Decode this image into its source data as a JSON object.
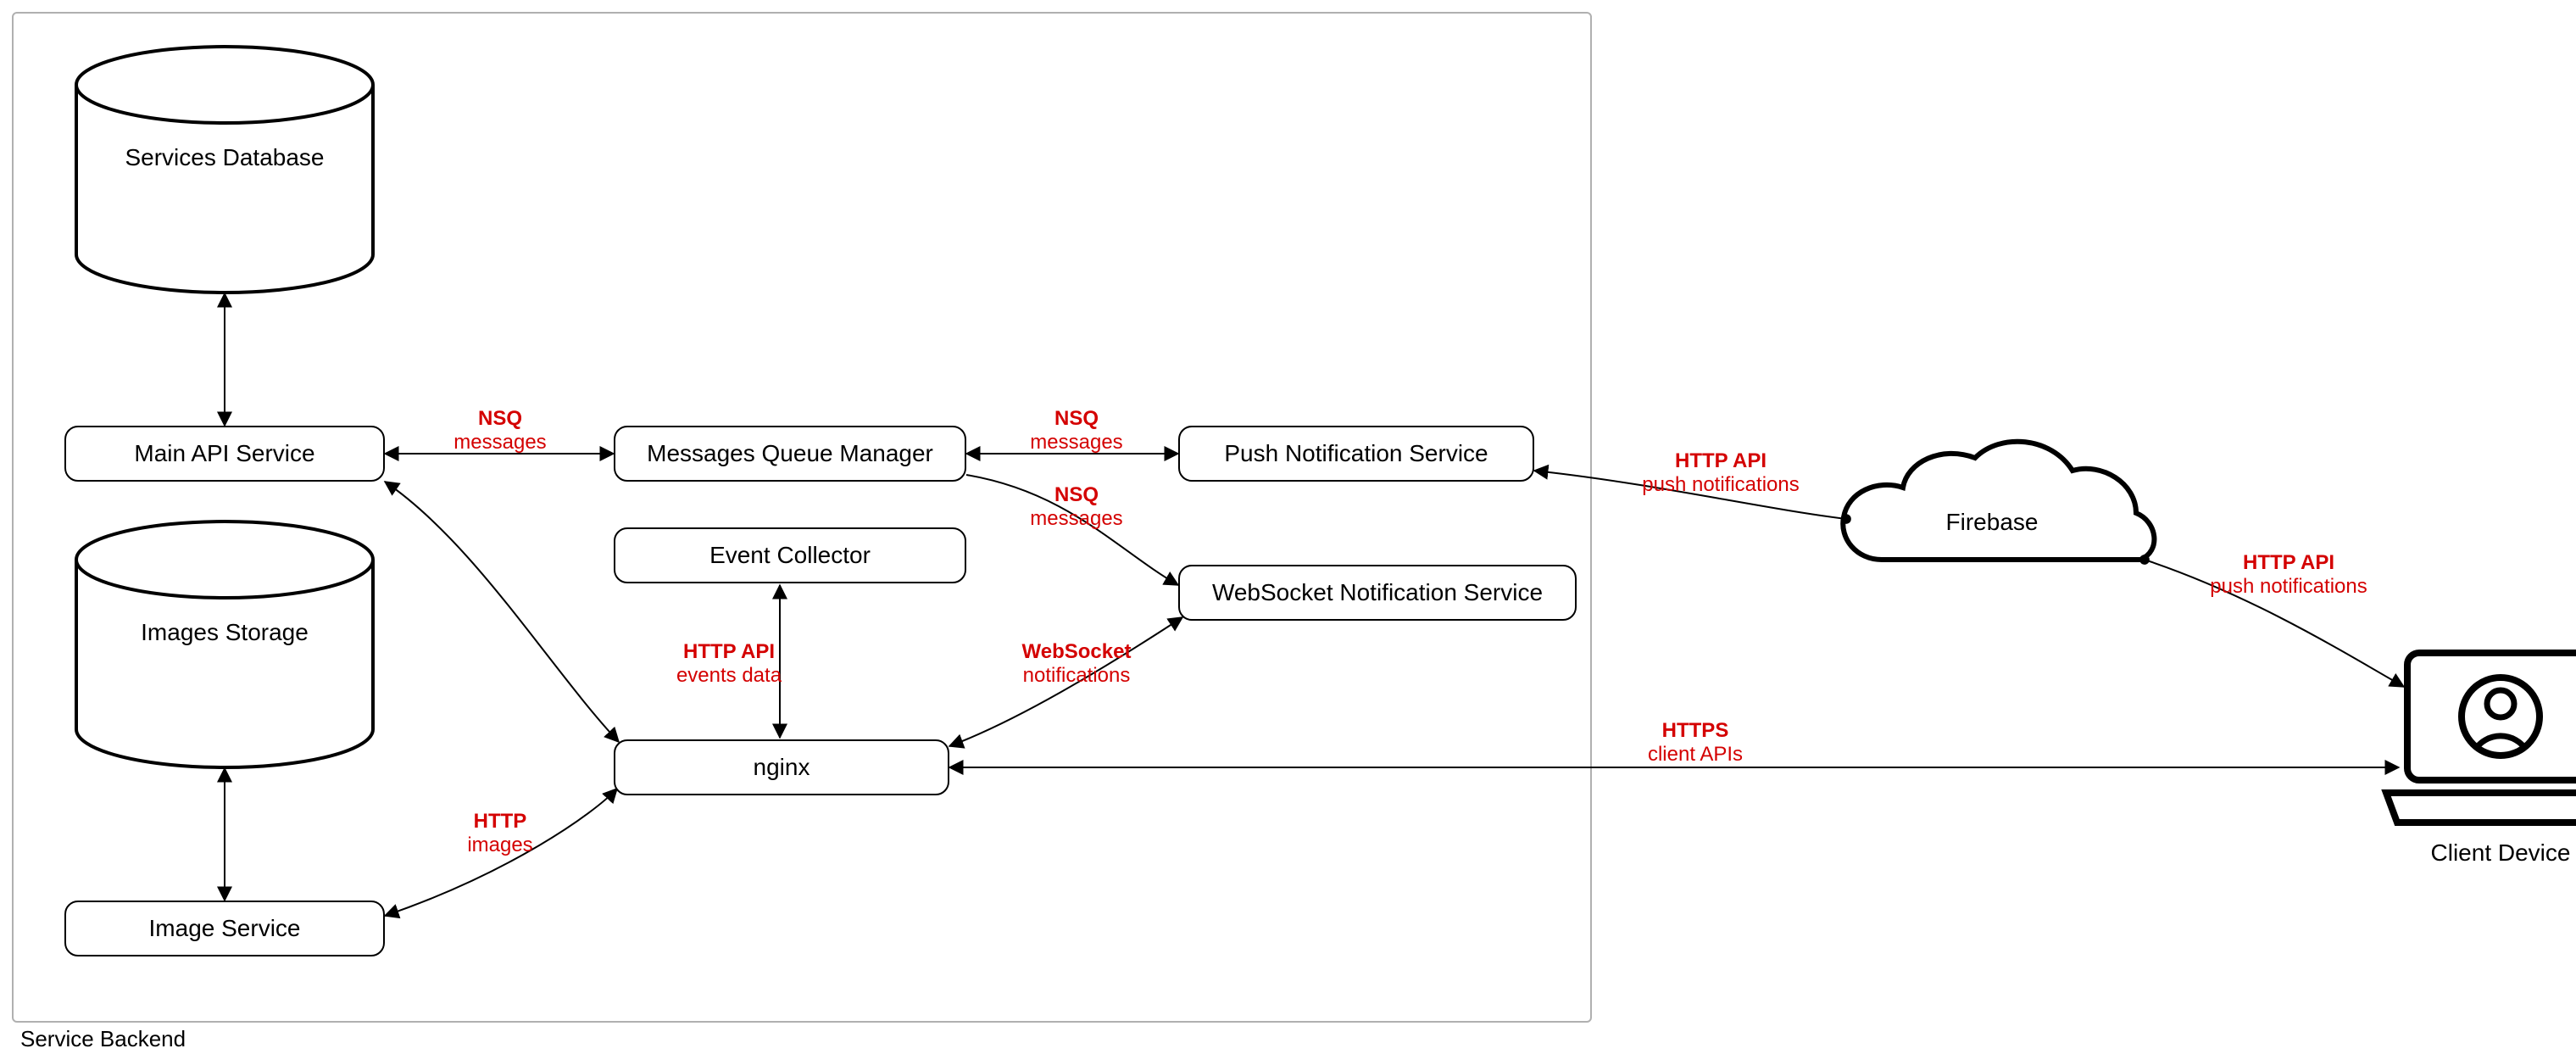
{
  "container": {
    "label": "Service Backend"
  },
  "nodes": {
    "services_db": {
      "label": "Services Database",
      "kind": "database"
    },
    "images_storage": {
      "label": "Images Storage",
      "kind": "database"
    },
    "main_api": {
      "label": "Main API Service",
      "kind": "service"
    },
    "image_service": {
      "label": "Image Service",
      "kind": "service"
    },
    "mq_manager": {
      "label": "Messages Queue Manager",
      "kind": "service"
    },
    "event_collector": {
      "label": "Event Collector",
      "kind": "service"
    },
    "nginx": {
      "label": "nginx",
      "kind": "service"
    },
    "push_service": {
      "label": "Push Notification Service",
      "kind": "service"
    },
    "ws_service": {
      "label": "WebSocket Notification Service",
      "kind": "service"
    },
    "firebase": {
      "label": "Firebase",
      "kind": "cloud"
    },
    "client": {
      "label": "Client Device",
      "kind": "device"
    }
  },
  "edges": {
    "db_api": {
      "from": "services_db",
      "to": "main_api",
      "bidir": true
    },
    "api_mq": {
      "from": "main_api",
      "to": "mq_manager",
      "bidir": true,
      "label_bold": "NSQ",
      "label_sub": "messages"
    },
    "mq_push": {
      "from": "mq_manager",
      "to": "push_service",
      "bidir": true,
      "label_bold": "NSQ",
      "label_sub": "messages"
    },
    "mq_ws": {
      "from": "mq_manager",
      "to": "ws_service",
      "bidir": false,
      "label_bold": "NSQ",
      "label_sub": "messages"
    },
    "ev_nginx": {
      "from": "event_collector",
      "to": "nginx",
      "bidir": true,
      "label_bold": "HTTP API",
      "label_sub": "events data"
    },
    "ws_nginx": {
      "from": "ws_service",
      "to": "nginx",
      "bidir": true,
      "label_bold": "WebSocket",
      "label_sub": "notifications"
    },
    "imgstore_imgsvc": {
      "from": "images_storage",
      "to": "image_service",
      "bidir": true
    },
    "imgsvc_nginx": {
      "from": "image_service",
      "to": "nginx",
      "bidir": true,
      "label_bold": "HTTP",
      "label_sub": "images"
    },
    "api_nginx": {
      "from": "main_api",
      "to": "nginx",
      "bidir": true
    },
    "push_firebase": {
      "from": "push_service",
      "to": "firebase",
      "bidir": true,
      "label_bold": "HTTP API",
      "label_sub": "push notifications"
    },
    "firebase_client": {
      "from": "firebase",
      "to": "client",
      "bidir": true,
      "label_bold": "HTTP API",
      "label_sub": "push notifications"
    },
    "nginx_client": {
      "from": "nginx",
      "to": "client",
      "bidir": true,
      "label_bold": "HTTPS",
      "label_sub": "client APIs"
    }
  }
}
